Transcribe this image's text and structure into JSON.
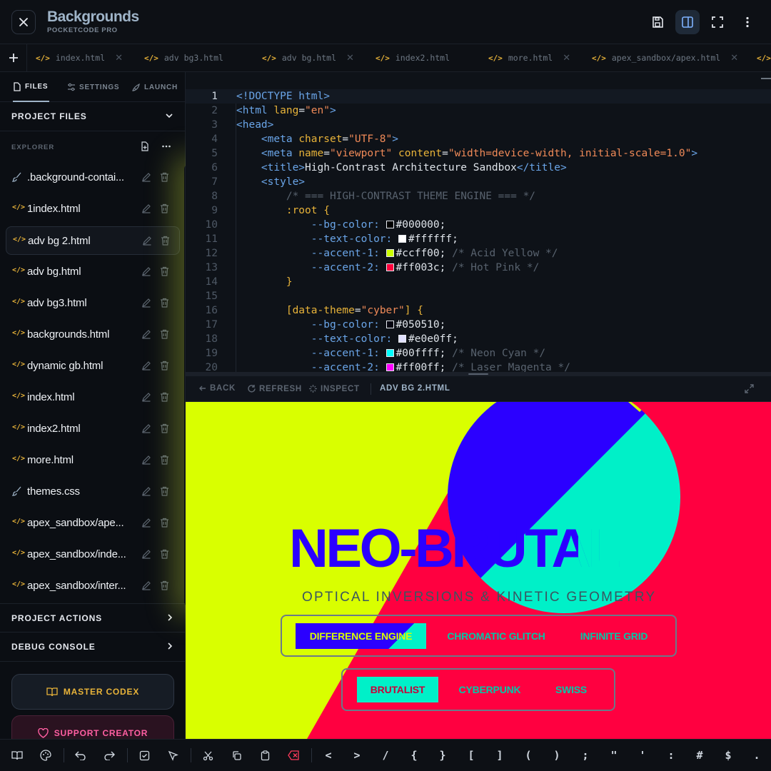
{
  "app": {
    "title": "Backgrounds",
    "subtitle": "POCKETCODE PRO"
  },
  "tabs": [
    {
      "label": "index.html"
    },
    {
      "label": "adv bg3.html"
    },
    {
      "label": "adv bg.html"
    },
    {
      "label": "index2.html"
    },
    {
      "label": "more.html"
    },
    {
      "label": "apex_sandbox/apex.html"
    }
  ],
  "sidebar": {
    "tabs": [
      {
        "label": "FILES"
      },
      {
        "label": "SETTINGS"
      },
      {
        "label": "LAUNCH"
      }
    ],
    "project_files": "PROJECT FILES",
    "explorer": "EXPLORER",
    "files": [
      {
        "name": ".background-contai...",
        "icon": "css-brush-icon"
      },
      {
        "name": "1index.html",
        "icon": "code-icon"
      },
      {
        "name": "adv bg 2.html",
        "icon": "code-icon"
      },
      {
        "name": "adv bg.html",
        "icon": "code-icon"
      },
      {
        "name": "adv bg3.html",
        "icon": "code-icon"
      },
      {
        "name": "backgrounds.html",
        "icon": "code-icon"
      },
      {
        "name": "dynamic gb.html",
        "icon": "code-icon"
      },
      {
        "name": "index.html",
        "icon": "code-icon"
      },
      {
        "name": "index2.html",
        "icon": "code-icon"
      },
      {
        "name": "more.html",
        "icon": "code-icon"
      },
      {
        "name": "themes.css",
        "icon": "css-brush-icon"
      },
      {
        "name": "apex_sandbox/ape...",
        "icon": "code-icon"
      },
      {
        "name": "apex_sandbox/inde...",
        "icon": "code-icon"
      },
      {
        "name": "apex_sandbox/inter...",
        "icon": "code-icon"
      }
    ],
    "project_actions": "PROJECT ACTIONS",
    "debug_console": "DEBUG CONSOLE",
    "master_codex": "MASTER CODEX",
    "support_creator": "SUPPORT CREATOR"
  },
  "editor": {
    "current_line": 1,
    "lines": [
      {
        "n": "1"
      },
      {
        "n": "2"
      },
      {
        "n": "3"
      },
      {
        "n": "4"
      },
      {
        "n": "5"
      },
      {
        "n": "6"
      },
      {
        "n": "7"
      },
      {
        "n": "8"
      },
      {
        "n": "9"
      },
      {
        "n": "10"
      },
      {
        "n": "11"
      },
      {
        "n": "12"
      },
      {
        "n": "13"
      },
      {
        "n": "14"
      },
      {
        "n": "15"
      },
      {
        "n": "16"
      },
      {
        "n": "17"
      },
      {
        "n": "18"
      },
      {
        "n": "19"
      },
      {
        "n": "20"
      }
    ],
    "tokens": {
      "doctype": "<!DOCTYPE html>",
      "html_open": "<html",
      "lang_attr": "lang",
      "lang_val": "\"en\"",
      "head_open": "<head>",
      "meta": "<meta",
      "charset_attr": "charset",
      "charset_val": "\"UTF-8\"",
      "name_attr": "name",
      "name_val": "\"viewport\"",
      "content_attr": "content",
      "content_val": "\"width=device-width, initial-scale=1.0\"",
      "title_open": "<title>",
      "title_text": "High-Contrast Architecture Sandbox",
      "title_close": "</title>",
      "style_open": "<style>",
      "comment_engine": "/* === HIGH-CONTRAST THEME ENGINE === */",
      "root_sel": ":root",
      "bg_color_prop": "--bg-color:",
      "text_color_prop": "--text-color:",
      "accent1_prop": "--accent-1:",
      "accent2_prop": "--accent-2:",
      "v_000000": "#000000;",
      "v_ffffff": "#ffffff;",
      "v_ccff00": "#ccff00;",
      "c_acid": "/* Acid Yellow */",
      "v_ff003c": "#ff003c;",
      "c_hotpink": "/* Hot Pink */",
      "theme_attr": "data-theme",
      "theme_val": "\"cyber\"",
      "v_050510": "#050510;",
      "v_e0e0ff": "#e0e0ff;",
      "v_00ffff": "#00ffff;",
      "c_cyan": "/* Neon Cyan */",
      "v_ff00ff": "#ff00ff;",
      "c_magenta": "/* Laser Magenta */"
    },
    "swatches": {
      "black": "#000000",
      "white": "#ffffff",
      "acid": "#ccff00",
      "pink": "#ff003c",
      "dark": "#050510",
      "lavender": "#e0e0ff",
      "cyan": "#00ffff",
      "magenta": "#ff00ff"
    }
  },
  "preview_bar": {
    "back": "BACK",
    "refresh": "REFRESH",
    "inspect": "INSPECT",
    "file": "ADV BG 2.HTML"
  },
  "preview": {
    "headline": "NEO-BRUTAL",
    "subline": "OPTICAL INVERSIONS & KINETIC GEOMETRY",
    "row1": [
      "DIFFERENCE ENGINE",
      "CHROMATIC GLITCH",
      "INFINITE GRID"
    ],
    "row2": [
      "BRUTALIST",
      "CYBERPUNK",
      "SWISS"
    ],
    "colors": {
      "yellow": "#d9ff00",
      "red": "#ff0040",
      "blue": "#2b00ff",
      "mint": "#00f0c8"
    }
  },
  "bottom_toolbar": {
    "keys": [
      "<",
      ">",
      "/",
      "{",
      "}",
      "[",
      "]",
      "(",
      ")",
      ";",
      "\"",
      "'",
      ":",
      "#",
      "$",
      "."
    ]
  }
}
